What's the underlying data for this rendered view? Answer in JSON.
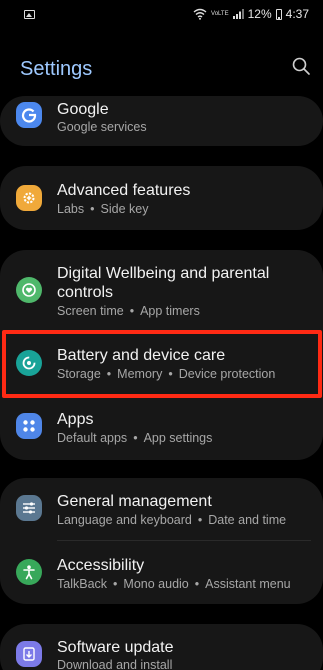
{
  "status_bar": {
    "signal_label": "VoLTE",
    "battery": "12%",
    "time": "4:37"
  },
  "header": {
    "title": "Settings"
  },
  "items": [
    {
      "title": "Google",
      "subtitle": "Google services"
    },
    {
      "title": "Advanced features",
      "subtitle_parts": [
        "Labs",
        "Side key"
      ]
    },
    {
      "title_line1": "Digital Wellbeing and parental",
      "title_line2": "controls",
      "subtitle_parts": [
        "Screen time",
        "App timers"
      ]
    },
    {
      "title": "Battery and device care",
      "subtitle_parts": [
        "Storage",
        "Memory",
        "Device protection"
      ]
    },
    {
      "title": "Apps",
      "subtitle_parts": [
        "Default apps",
        "App settings"
      ]
    },
    {
      "title": "General management",
      "subtitle_parts": [
        "Language and keyboard",
        "Date and time"
      ]
    },
    {
      "title": "Accessibility",
      "subtitle_parts": [
        "TalkBack",
        "Mono audio",
        "Assistant menu"
      ]
    },
    {
      "title": "Software update",
      "subtitle": "Download and install"
    }
  ],
  "colors": {
    "accent_title": "#9ec9ff",
    "highlight": "#ff2a14",
    "google_icon": "#4c88ee",
    "advanced_icon": "#f0a93a",
    "wellbeing_icon": "#4fb86b",
    "battery_icon": "#19a398",
    "apps_icon": "#4f86e8",
    "general_icon": "#5b7891",
    "accessibility_icon": "#38a85a",
    "update_icon": "#7c7ae8"
  },
  "icons": {
    "google": "google-g-icon",
    "advanced": "gear-plus-icon",
    "wellbeing": "heart-ring-icon",
    "battery": "device-care-icon",
    "apps": "four-dots-icon",
    "general": "sliders-icon",
    "accessibility": "person-icon",
    "update": "download-icon"
  }
}
